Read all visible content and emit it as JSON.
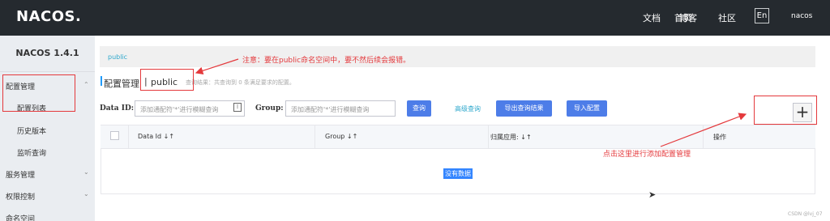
{
  "header": {
    "logo": "NACOS.",
    "nav": [
      "首页",
      "文档",
      "博客",
      "社区"
    ],
    "lang_button": "En",
    "user": "nacos"
  },
  "sidebar": {
    "version": "NACOS 1.4.1",
    "items": [
      {
        "label": "配置管理",
        "expanded": true
      },
      {
        "label": "配置列表",
        "sub": true
      },
      {
        "label": "历史版本",
        "sub": true
      },
      {
        "label": "监听查询",
        "sub": true
      },
      {
        "label": "服务管理"
      },
      {
        "label": "权限控制"
      },
      {
        "label": "命名空间"
      }
    ]
  },
  "namespace": {
    "tab": "public"
  },
  "annotation_note": "注意：要在public命名空间中，要不然后续会报错。",
  "annotation_add": "点击这里进行添加配置管理",
  "page": {
    "title": "配置管理",
    "separator": "|",
    "namespace": "public",
    "query_result": "查询结果：共查询到 0 条满足要求的配置。"
  },
  "search": {
    "data_id_label": "Data ID:",
    "data_id_placeholder": "添加通配符'*'进行模糊查询",
    "group_label": "Group:",
    "group_placeholder": "添加通配符'*'进行模糊查询",
    "query_button": "查询",
    "advanced_query": "高级查询",
    "export_button": "导出查询结果",
    "import_button": "导入配置",
    "add_button": "+"
  },
  "table": {
    "columns": [
      "Data Id ↓↑",
      "Group ↓↑",
      "归属应用: ↓↑",
      "操作"
    ],
    "rows": [],
    "empty_text": "没有数据"
  },
  "watermark": "CSDN @lvj_07",
  "colors": {
    "topbar": "#252a2f",
    "sidebar": "#eaedf1",
    "primary": "#4d7de8",
    "annotation": "#e4393c"
  }
}
